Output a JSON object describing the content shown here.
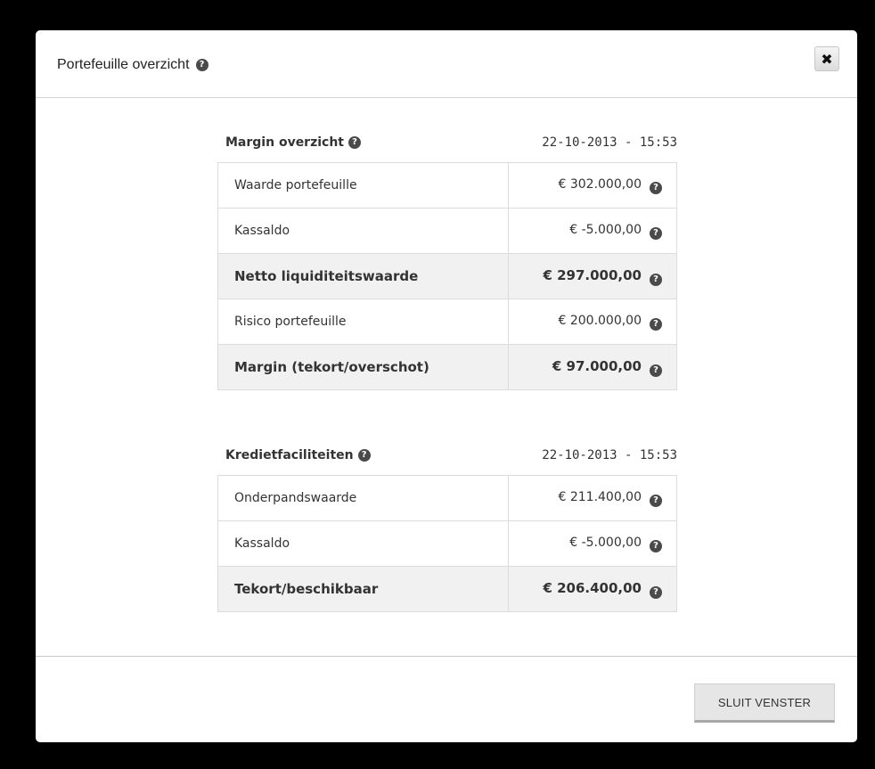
{
  "modal": {
    "title": "Portefeuille overzicht",
    "close_icon": "close-icon",
    "close_glyph": "✖"
  },
  "margin": {
    "title": "Margin overzicht",
    "date": "22-10-2013 - 15:53",
    "rows": [
      {
        "label": "Waarde portefeuille",
        "value": "€ 302.000,00",
        "bold": false
      },
      {
        "label": "Kassaldo",
        "value": "€ -5.000,00",
        "bold": false
      },
      {
        "label": "Netto liquiditeitswaarde",
        "value": "€ 297.000,00",
        "bold": true
      },
      {
        "label": "Risico portefeuille",
        "value": "€ 200.000,00",
        "bold": false
      },
      {
        "label": "Margin (tekort/overschot)",
        "value": "€ 97.000,00",
        "bold": true
      }
    ]
  },
  "krediet": {
    "title": "Kredietfaciliteiten",
    "date": "22-10-2013 - 15:53",
    "rows": [
      {
        "label": "Onderpandswaarde",
        "value": "€ 211.400,00",
        "bold": false
      },
      {
        "label": "Kassaldo",
        "value": "€ -5.000,00",
        "bold": false
      },
      {
        "label": "Tekort/beschikbaar",
        "value": "€ 206.400,00",
        "bold": true
      }
    ]
  },
  "footer": {
    "close_label": "SLUIT VENSTER"
  },
  "help_glyph": "?",
  "colors": {
    "backdrop": "#000000",
    "highlight_row": "#f1f1f1",
    "help_icon": "#4a4a4a"
  }
}
